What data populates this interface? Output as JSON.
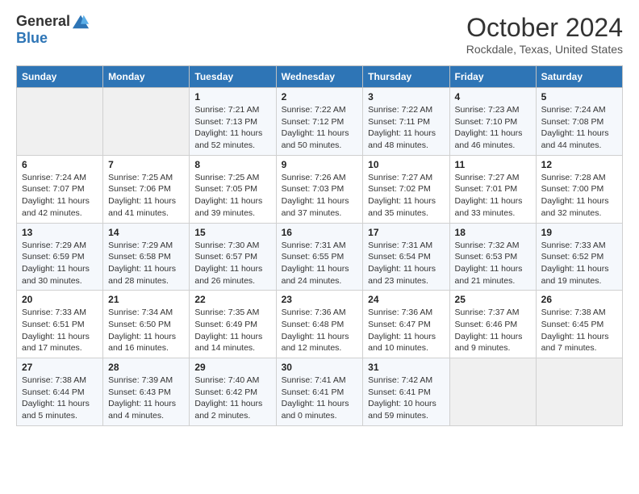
{
  "header": {
    "logo_line1": "General",
    "logo_line2": "Blue",
    "month": "October 2024",
    "location": "Rockdale, Texas, United States"
  },
  "weekdays": [
    "Sunday",
    "Monday",
    "Tuesday",
    "Wednesday",
    "Thursday",
    "Friday",
    "Saturday"
  ],
  "weeks": [
    [
      {
        "day": "",
        "sunrise": "",
        "sunset": "",
        "daylight": ""
      },
      {
        "day": "",
        "sunrise": "",
        "sunset": "",
        "daylight": ""
      },
      {
        "day": "1",
        "sunrise": "Sunrise: 7:21 AM",
        "sunset": "Sunset: 7:13 PM",
        "daylight": "Daylight: 11 hours and 52 minutes."
      },
      {
        "day": "2",
        "sunrise": "Sunrise: 7:22 AM",
        "sunset": "Sunset: 7:12 PM",
        "daylight": "Daylight: 11 hours and 50 minutes."
      },
      {
        "day": "3",
        "sunrise": "Sunrise: 7:22 AM",
        "sunset": "Sunset: 7:11 PM",
        "daylight": "Daylight: 11 hours and 48 minutes."
      },
      {
        "day": "4",
        "sunrise": "Sunrise: 7:23 AM",
        "sunset": "Sunset: 7:10 PM",
        "daylight": "Daylight: 11 hours and 46 minutes."
      },
      {
        "day": "5",
        "sunrise": "Sunrise: 7:24 AM",
        "sunset": "Sunset: 7:08 PM",
        "daylight": "Daylight: 11 hours and 44 minutes."
      }
    ],
    [
      {
        "day": "6",
        "sunrise": "Sunrise: 7:24 AM",
        "sunset": "Sunset: 7:07 PM",
        "daylight": "Daylight: 11 hours and 42 minutes."
      },
      {
        "day": "7",
        "sunrise": "Sunrise: 7:25 AM",
        "sunset": "Sunset: 7:06 PM",
        "daylight": "Daylight: 11 hours and 41 minutes."
      },
      {
        "day": "8",
        "sunrise": "Sunrise: 7:25 AM",
        "sunset": "Sunset: 7:05 PM",
        "daylight": "Daylight: 11 hours and 39 minutes."
      },
      {
        "day": "9",
        "sunrise": "Sunrise: 7:26 AM",
        "sunset": "Sunset: 7:03 PM",
        "daylight": "Daylight: 11 hours and 37 minutes."
      },
      {
        "day": "10",
        "sunrise": "Sunrise: 7:27 AM",
        "sunset": "Sunset: 7:02 PM",
        "daylight": "Daylight: 11 hours and 35 minutes."
      },
      {
        "day": "11",
        "sunrise": "Sunrise: 7:27 AM",
        "sunset": "Sunset: 7:01 PM",
        "daylight": "Daylight: 11 hours and 33 minutes."
      },
      {
        "day": "12",
        "sunrise": "Sunrise: 7:28 AM",
        "sunset": "Sunset: 7:00 PM",
        "daylight": "Daylight: 11 hours and 32 minutes."
      }
    ],
    [
      {
        "day": "13",
        "sunrise": "Sunrise: 7:29 AM",
        "sunset": "Sunset: 6:59 PM",
        "daylight": "Daylight: 11 hours and 30 minutes."
      },
      {
        "day": "14",
        "sunrise": "Sunrise: 7:29 AM",
        "sunset": "Sunset: 6:58 PM",
        "daylight": "Daylight: 11 hours and 28 minutes."
      },
      {
        "day": "15",
        "sunrise": "Sunrise: 7:30 AM",
        "sunset": "Sunset: 6:57 PM",
        "daylight": "Daylight: 11 hours and 26 minutes."
      },
      {
        "day": "16",
        "sunrise": "Sunrise: 7:31 AM",
        "sunset": "Sunset: 6:55 PM",
        "daylight": "Daylight: 11 hours and 24 minutes."
      },
      {
        "day": "17",
        "sunrise": "Sunrise: 7:31 AM",
        "sunset": "Sunset: 6:54 PM",
        "daylight": "Daylight: 11 hours and 23 minutes."
      },
      {
        "day": "18",
        "sunrise": "Sunrise: 7:32 AM",
        "sunset": "Sunset: 6:53 PM",
        "daylight": "Daylight: 11 hours and 21 minutes."
      },
      {
        "day": "19",
        "sunrise": "Sunrise: 7:33 AM",
        "sunset": "Sunset: 6:52 PM",
        "daylight": "Daylight: 11 hours and 19 minutes."
      }
    ],
    [
      {
        "day": "20",
        "sunrise": "Sunrise: 7:33 AM",
        "sunset": "Sunset: 6:51 PM",
        "daylight": "Daylight: 11 hours and 17 minutes."
      },
      {
        "day": "21",
        "sunrise": "Sunrise: 7:34 AM",
        "sunset": "Sunset: 6:50 PM",
        "daylight": "Daylight: 11 hours and 16 minutes."
      },
      {
        "day": "22",
        "sunrise": "Sunrise: 7:35 AM",
        "sunset": "Sunset: 6:49 PM",
        "daylight": "Daylight: 11 hours and 14 minutes."
      },
      {
        "day": "23",
        "sunrise": "Sunrise: 7:36 AM",
        "sunset": "Sunset: 6:48 PM",
        "daylight": "Daylight: 11 hours and 12 minutes."
      },
      {
        "day": "24",
        "sunrise": "Sunrise: 7:36 AM",
        "sunset": "Sunset: 6:47 PM",
        "daylight": "Daylight: 11 hours and 10 minutes."
      },
      {
        "day": "25",
        "sunrise": "Sunrise: 7:37 AM",
        "sunset": "Sunset: 6:46 PM",
        "daylight": "Daylight: 11 hours and 9 minutes."
      },
      {
        "day": "26",
        "sunrise": "Sunrise: 7:38 AM",
        "sunset": "Sunset: 6:45 PM",
        "daylight": "Daylight: 11 hours and 7 minutes."
      }
    ],
    [
      {
        "day": "27",
        "sunrise": "Sunrise: 7:38 AM",
        "sunset": "Sunset: 6:44 PM",
        "daylight": "Daylight: 11 hours and 5 minutes."
      },
      {
        "day": "28",
        "sunrise": "Sunrise: 7:39 AM",
        "sunset": "Sunset: 6:43 PM",
        "daylight": "Daylight: 11 hours and 4 minutes."
      },
      {
        "day": "29",
        "sunrise": "Sunrise: 7:40 AM",
        "sunset": "Sunset: 6:42 PM",
        "daylight": "Daylight: 11 hours and 2 minutes."
      },
      {
        "day": "30",
        "sunrise": "Sunrise: 7:41 AM",
        "sunset": "Sunset: 6:41 PM",
        "daylight": "Daylight: 11 hours and 0 minutes."
      },
      {
        "day": "31",
        "sunrise": "Sunrise: 7:42 AM",
        "sunset": "Sunset: 6:41 PM",
        "daylight": "Daylight: 10 hours and 59 minutes."
      },
      {
        "day": "",
        "sunrise": "",
        "sunset": "",
        "daylight": ""
      },
      {
        "day": "",
        "sunrise": "",
        "sunset": "",
        "daylight": ""
      }
    ]
  ]
}
